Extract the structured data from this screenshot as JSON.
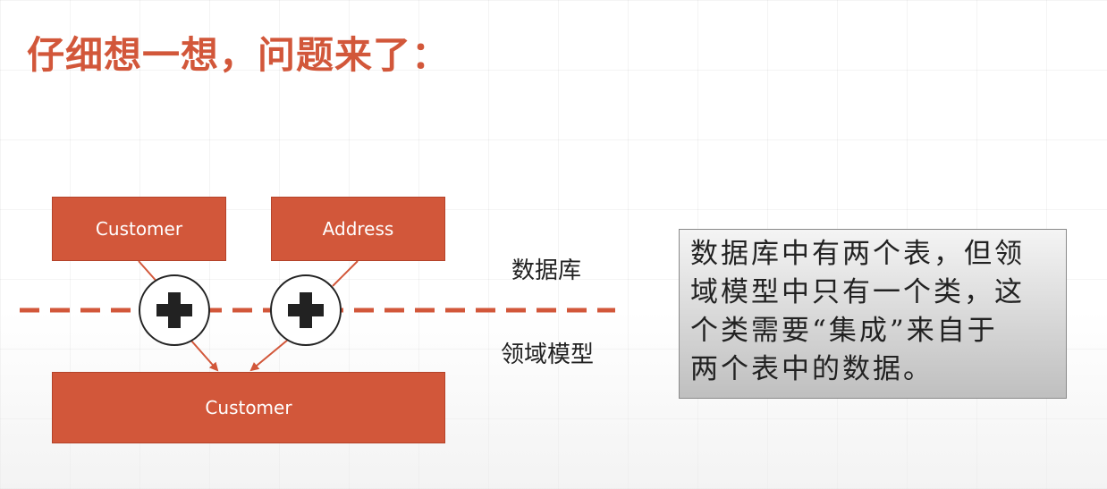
{
  "title": "仔细想一想，问题来了：",
  "boxes": {
    "customer_db": "Customer",
    "address_db": "Address",
    "customer_domain": "Customer"
  },
  "labels": {
    "database": "数据库",
    "domain_model": "领域模型"
  },
  "note": {
    "lines": [
      "数据库中有两个表，但领",
      "域模型中只有一个类，这",
      "个类需要“集成”来自于",
      "两个表中的数据。"
    ]
  },
  "colors": {
    "accent": "#d2573a",
    "note_bg_top": "#f4f4f4",
    "note_bg_bottom": "#bfbfbf"
  },
  "icons": [
    "plus-icon",
    "plus-icon"
  ]
}
